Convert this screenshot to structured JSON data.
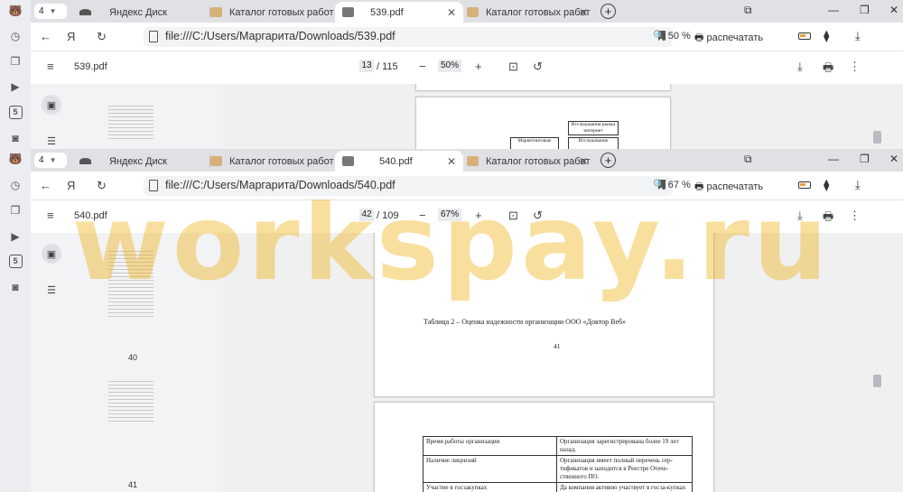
{
  "sidebar": {
    "icons": [
      "bear-logo-icon",
      "history-icon",
      "collections-icon",
      "music-player-icon",
      "five-icon",
      "screenshot-icon",
      "bear-logo-icon",
      "history-icon",
      "collections-icon",
      "music-player-icon",
      "five-icon",
      "screenshot-icon"
    ],
    "five_label": "5"
  },
  "win_top": {
    "tab_count": "4",
    "tabs": [
      {
        "label": "Яндекс Диск"
      },
      {
        "label": "Каталог готовых работ"
      },
      {
        "label": "539.pdf",
        "active": true
      },
      {
        "label": "Каталог готовых работ"
      }
    ],
    "url": "file:///C:/Users/Маргарита/Downloads/539.pdf",
    "zoom": "50 %",
    "print": "распечатать",
    "pdf": {
      "filename": "539.pdf",
      "page": "13",
      "total": "/ 115",
      "zoom": "50%"
    },
    "diagram": {
      "box1": "Исследования рынка интернет",
      "box2": "Маркетинговые",
      "box3": "Исследование"
    }
  },
  "win_bottom": {
    "tab_count": "4",
    "tabs": [
      {
        "label": "Яндекс Диск"
      },
      {
        "label": "Каталог готовых работ"
      },
      {
        "label": "540.pdf",
        "active": true
      },
      {
        "label": "Каталог готовых работ"
      }
    ],
    "url": "file:///C:/Users/Маргарита/Downloads/540.pdf",
    "zoom": "67 %",
    "print": "распечатать",
    "pdf": {
      "filename": "540.pdf",
      "page": "42",
      "total": "/ 109",
      "zoom": "67%"
    },
    "thumb_numbers": [
      "40",
      "41"
    ],
    "page41": {
      "caption": "Таблица 2 – Оценка надежности организации ООО «Доктор Веб»",
      "number": "41"
    },
    "table": {
      "rows": [
        [
          "Время работы организации",
          "Организация зарегистрирована более 19 лет назад."
        ],
        [
          "Наличие лицензий",
          "Организация имеет полный перечень сер-тификатов и находится в Реестре Отече-ственного ПО."
        ],
        [
          "Участие в госзакупках",
          "Да компания активно участвует в госза-купках и осуществляла услуги на более чем"
        ]
      ]
    }
  },
  "watermark": "workspay.ru",
  "colors": {
    "accent_orange": "#eeaa00",
    "tabbar": "#dfe1e5"
  }
}
